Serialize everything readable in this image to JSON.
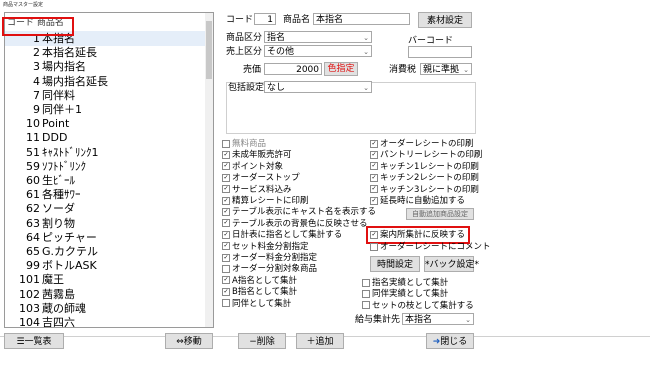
{
  "window": {
    "title": "商品マスター設定"
  },
  "list": {
    "header": "コード 商品名",
    "items": [
      {
        "code": "1",
        "name": "本指名"
      },
      {
        "code": "2",
        "name": "本指名延長"
      },
      {
        "code": "3",
        "name": "場内指名"
      },
      {
        "code": "4",
        "name": "場内指名延長"
      },
      {
        "code": "7",
        "name": "同伴料"
      },
      {
        "code": "9",
        "name": "同伴＋1"
      },
      {
        "code": "10",
        "name": "Point"
      },
      {
        "code": "11",
        "name": "DDD"
      },
      {
        "code": "51",
        "name": "ｷｬｽﾄﾄﾞﾘﾝｸ1"
      },
      {
        "code": "59",
        "name": "ｿﾌﾄﾄﾞﾘﾝｸ"
      },
      {
        "code": "60",
        "name": "生ﾋﾞｰﾙ"
      },
      {
        "code": "61",
        "name": "各種ｻﾜｰ"
      },
      {
        "code": "62",
        "name": "ソーダ"
      },
      {
        "code": "63",
        "name": "割り物"
      },
      {
        "code": "64",
        "name": "ピッチャー"
      },
      {
        "code": "65",
        "name": "G.カクテル"
      },
      {
        "code": "99",
        "name": "ボトルASK"
      },
      {
        "code": "101",
        "name": "魔王"
      },
      {
        "code": "102",
        "name": "茜霧島"
      },
      {
        "code": "103",
        "name": "蔵の師魂"
      },
      {
        "code": "104",
        "name": "吉四六"
      }
    ]
  },
  "form": {
    "code_label": "コード",
    "code_value": "1",
    "name_label": "商品名",
    "name_value": "本指名",
    "material_button": "素材設定",
    "category_label": "商品区分",
    "category_value": "指名",
    "sales_label": "売上区分",
    "sales_value": "その他",
    "barcode_label": "バーコード",
    "barcode_value": "",
    "price_label": "売価",
    "price_value": "2000",
    "color_button": "色指定",
    "tax_label": "消費税",
    "tax_value": "親に準拠",
    "package_label": "包括設定",
    "package_value": "なし"
  },
  "checks_left": [
    {
      "label": "無料商品",
      "checked": false,
      "grey": true
    },
    {
      "label": "未成年販売許可",
      "checked": true
    },
    {
      "label": "ポイント対象",
      "checked": true
    },
    {
      "label": "オーダーストップ",
      "checked": true
    },
    {
      "label": "サービス料込み",
      "checked": true
    },
    {
      "label": "精算レシートに印刷",
      "checked": true
    },
    {
      "label": "テーブル表示にキャスト名を表示する",
      "checked": true
    },
    {
      "label": "テーブル表示の背景色に反映させる",
      "checked": true
    },
    {
      "label": "日計表に指名として集計する",
      "checked": true
    },
    {
      "label": "セット料金分割指定",
      "checked": true
    },
    {
      "label": "オーダー料金分割指定",
      "checked": true
    },
    {
      "label": "オーダー分割対象商品",
      "checked": false
    },
    {
      "label": "A指名として集計",
      "checked": true
    },
    {
      "label": "B指名として集計",
      "checked": true
    },
    {
      "label": "同伴として集計",
      "checked": false
    }
  ],
  "checks_right": [
    {
      "label": "オーダーレシートの印刷",
      "checked": true
    },
    {
      "label": "パントリーレシートの印刷",
      "checked": true
    },
    {
      "label": "キッチン1レシートの印刷",
      "checked": true
    },
    {
      "label": "キッチン2レシートの印刷",
      "checked": true
    },
    {
      "label": "キッチン3レシートの印刷",
      "checked": true
    },
    {
      "label": "延長時に自動追加する",
      "checked": true
    }
  ],
  "checks_right2": [
    {
      "label": "指名実績として集計",
      "checked": false
    },
    {
      "label": "同伴実績として集計",
      "checked": false
    },
    {
      "label": "セットの枝として集計する",
      "checked": false
    }
  ],
  "auto_add_button": "自動追加商品設定",
  "guide_check": "案内所集計に反映する",
  "order_receipt_comment": "オーダーレシートにコメント",
  "time_setting_button": "時間設定",
  "back_setting_button": "*バック設定*",
  "salary_label": "給与集計先",
  "salary_value": "本指名",
  "footer": {
    "list_button": "一覧表",
    "move_button": "移動",
    "delete_button": "削除",
    "add_button": "追加",
    "close_button": "閉じる"
  }
}
